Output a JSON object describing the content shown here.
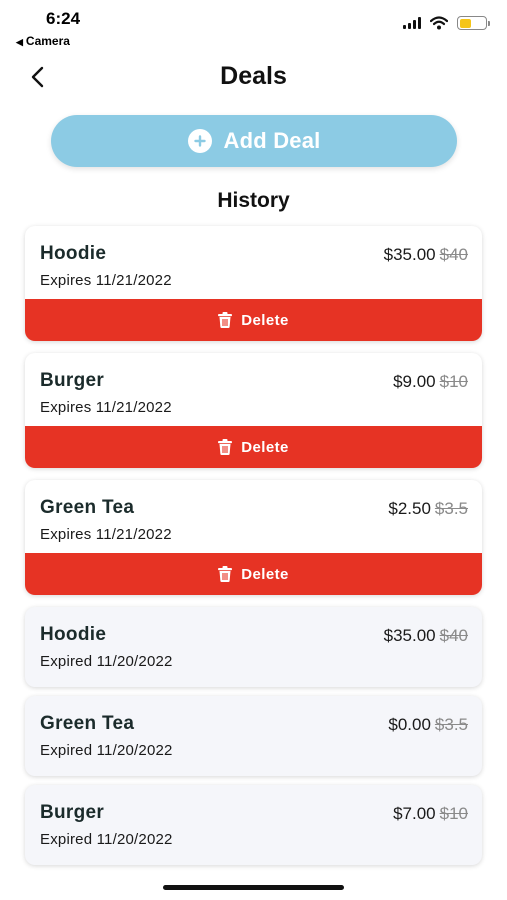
{
  "status_bar": {
    "time": "6:24",
    "back_app": "Camera",
    "back_glyph": "◀",
    "battery_color": "#f5c518"
  },
  "nav": {
    "title": "Deals",
    "back_icon": "chevron-left-icon"
  },
  "add_deal": {
    "label": "Add Deal",
    "icon": "plus-circle-icon",
    "color": "#8ccbe4"
  },
  "section_title": "History",
  "colors": {
    "delete": "#e63324",
    "active_bg": "#ffffff",
    "expired_bg": "#f5f6fa"
  },
  "active_deals": [
    {
      "name": "Hoodie",
      "expiry": "Expires 11/21/2022",
      "price": "$35.00",
      "original": "$40",
      "delete_label": "Delete"
    },
    {
      "name": "Burger",
      "expiry": "Expires 11/21/2022",
      "price": "$9.00",
      "original": "$10",
      "delete_label": "Delete"
    },
    {
      "name": "Green Tea",
      "expiry": "Expires 11/21/2022",
      "price": "$2.50",
      "original": "$3.5",
      "delete_label": "Delete"
    }
  ],
  "expired_deals": [
    {
      "name": "Hoodie",
      "expiry": "Expired 11/20/2022",
      "price": "$35.00",
      "original": "$40"
    },
    {
      "name": "Green Tea",
      "expiry": "Expired 11/20/2022",
      "price": "$0.00",
      "original": "$3.5"
    },
    {
      "name": "Burger",
      "expiry": "Expired 11/20/2022",
      "price": "$7.00",
      "original": "$10"
    }
  ]
}
